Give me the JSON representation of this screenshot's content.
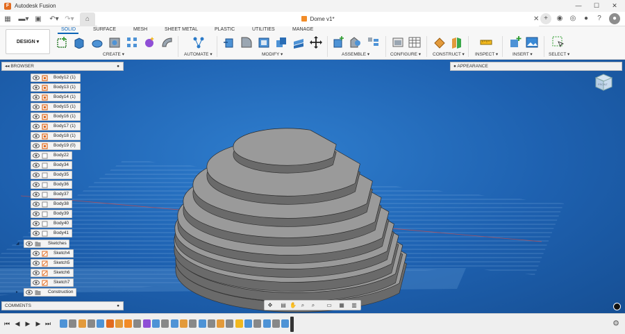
{
  "window": {
    "app_title": "Autodesk Fusion",
    "minimize": "—",
    "maximize": "☐",
    "close": "✕"
  },
  "document": {
    "tab_title": "Dome v1*"
  },
  "ribbon": {
    "workspace": "DESIGN ▾",
    "tabs": [
      "SOLID",
      "SURFACE",
      "MESH",
      "SHEET METAL",
      "PLASTIC",
      "UTILITIES",
      "MANAGE"
    ],
    "active_tab": "SOLID",
    "groups": [
      "CREATE ▾",
      "AUTOMATE ▾",
      "MODIFY ▾",
      "ASSEMBLE ▾",
      "CONFIGURE ▾",
      "CONSTRUCT ▾",
      "INSPECT ▾",
      "INSERT ▾",
      "SELECT ▾"
    ]
  },
  "browser": {
    "title": "BROWSER",
    "items": [
      {
        "label": "Body12 (1)",
        "kind": "link"
      },
      {
        "label": "Body13 (1)",
        "kind": "link"
      },
      {
        "label": "Body14 (1)",
        "kind": "link"
      },
      {
        "label": "Body15 (1)",
        "kind": "link"
      },
      {
        "label": "Body16 (1)",
        "kind": "link"
      },
      {
        "label": "Body17 (1)",
        "kind": "link"
      },
      {
        "label": "Body18 (1)",
        "kind": "link"
      },
      {
        "label": "Body19 (0)",
        "kind": "link"
      },
      {
        "label": "Body22",
        "kind": "body"
      },
      {
        "label": "Body34",
        "kind": "body"
      },
      {
        "label": "Body35",
        "kind": "body"
      },
      {
        "label": "Body36",
        "kind": "body"
      },
      {
        "label": "Body37",
        "kind": "body"
      },
      {
        "label": "Body38",
        "kind": "body"
      },
      {
        "label": "Body39",
        "kind": "body"
      },
      {
        "label": "Body40",
        "kind": "body"
      },
      {
        "label": "Body41",
        "kind": "body"
      }
    ],
    "sketches_folder": "Sketches",
    "sketches": [
      "Sketch4",
      "Sketch5",
      "Sketch6",
      "Sketch7"
    ],
    "construction_folder": "Construction"
  },
  "appearance": {
    "title": "APPEARANCE"
  },
  "comments": {
    "title": "COMMENTS"
  },
  "viewcube": {
    "face_label": "FRONT"
  },
  "colors": {
    "accent": "#0a63b6",
    "viewport": "#1e61b0",
    "body_top": "#9a9a9a",
    "body_side": "#6a6a6a",
    "link_icon": "#e26b1f"
  }
}
